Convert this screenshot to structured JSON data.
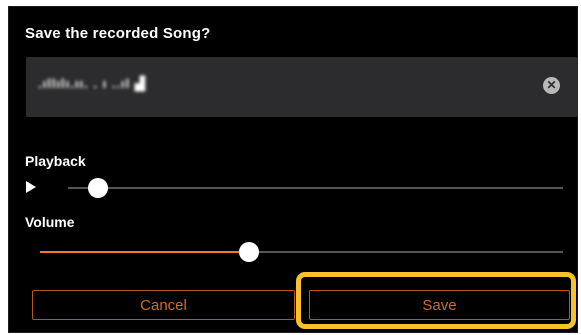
{
  "dialog": {
    "title": "Save the recorded Song?",
    "song_name_value": ".ıllılı.ıı. . ı ..ıl ▟",
    "clear_icon_glyph": "✕"
  },
  "playback": {
    "label": "Playback",
    "position_fraction": 0.06
  },
  "volume": {
    "label": "Volume",
    "level_fraction": 0.4
  },
  "buttons": {
    "cancel_label": "Cancel",
    "save_label": "Save"
  },
  "colors": {
    "accent": "#ec7a2c",
    "highlight": "#f5c22a",
    "background": "#000000",
    "field": "#2c2c2e"
  },
  "icons": {
    "clear": "clear-icon",
    "play": "play-icon"
  }
}
